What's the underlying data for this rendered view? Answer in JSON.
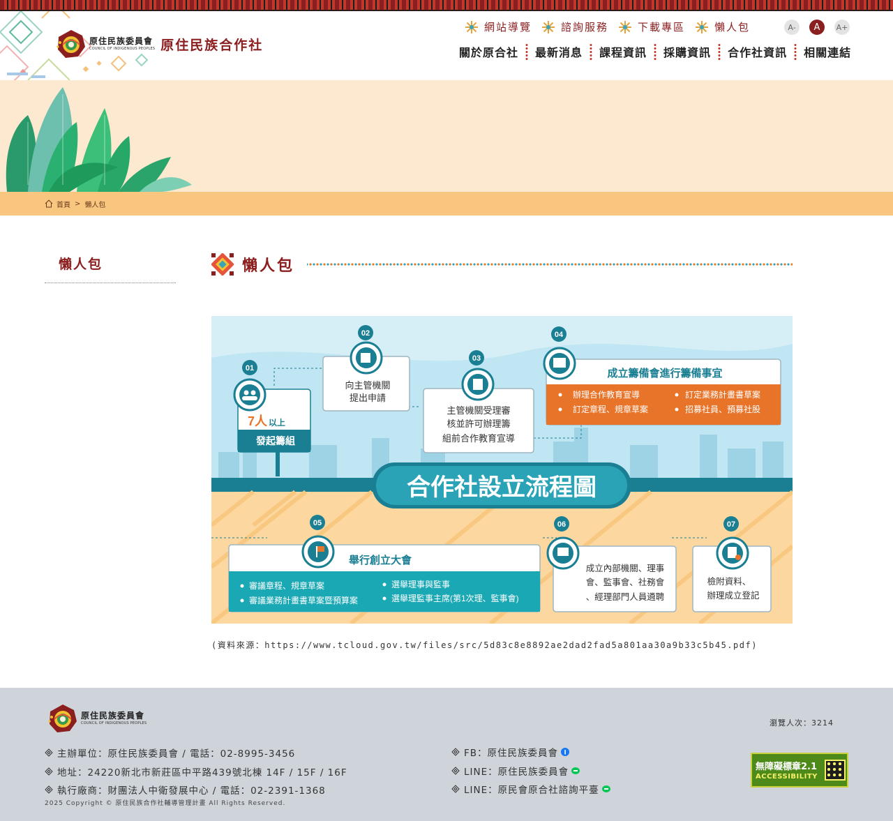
{
  "header": {
    "logo_cn": "原住民族委員會",
    "logo_en": "COUNCIL OF INDIGENOUS PEOPLES",
    "site_title": "原住民族合作社",
    "util_nav": [
      "網站導覽",
      "諮詢服務",
      "下載專區",
      "懶人包"
    ],
    "font_sizes": [
      "A-",
      "A",
      "A+"
    ],
    "main_nav": [
      "關於原合社",
      "最新消息",
      "課程資訊",
      "採購資訊",
      "合作社資訊",
      "相關連結"
    ]
  },
  "breadcrumb": {
    "home": "首頁",
    "separator": ">",
    "current": "懶人包"
  },
  "sidebar": {
    "title": "懶人包"
  },
  "content": {
    "title": "懶人包",
    "source_text": "(資料來源：https://www.tcloud.gov.tw/files/src/5d83c8e8892ae2dad2fad5a801aa30a9b33c5b45.pdf)"
  },
  "flowchart": {
    "title": "合作社設立流程圖",
    "steps": [
      {
        "num": "01",
        "highlight": "7人",
        "highlight_suffix": "以上",
        "label": "發起籌組"
      },
      {
        "num": "02",
        "lines": [
          "向主管機關",
          "提出申請"
        ]
      },
      {
        "num": "03",
        "lines": [
          "主管機關受理審",
          "核並許可辦理籌",
          "組前合作教育宣導"
        ]
      },
      {
        "num": "04",
        "title": "成立籌備會進行籌備事宜",
        "bullets": [
          "辦理合作教育宣導",
          "訂定業務計畫書草案",
          "訂定章程、規章草案",
          "招募社員、預募社股"
        ]
      },
      {
        "num": "05",
        "title": "舉行創立大會",
        "bullets": [
          "審議章程、規章草案",
          "選舉理事與監事",
          "審議業務計畫書草案暨預算案",
          "選舉理監事主席(第1次理、監事會)"
        ]
      },
      {
        "num": "06",
        "lines": [
          "成立內部機關、理事",
          "會、監事會、社務會",
          "、經理部門人員遴聘"
        ]
      },
      {
        "num": "07",
        "lines": [
          "檢附資料、",
          "辦理成立登記"
        ]
      }
    ]
  },
  "footer": {
    "logo_cn": "原住民族委員會",
    "logo_en": "COUNCIL OF INDIGENOUS PEOPLES",
    "visit": "瀏覽人次：3214",
    "left_lines": [
      "主辦單位：原住民族委員會 / 電話：02-8995-3456",
      "地址：24220新北市新莊區中平路439號北棟 14F / 15F / 16F",
      "執行廠商：財團法人中衛發展中心 / 電話：02-2391-1368"
    ],
    "right_lines": [
      "FB：原住民族委員會",
      "LINE：原住民族委員會",
      "LINE：原民會原合社諮詢平臺"
    ],
    "copyright": "2025 Copyright © 原住民族合作社輔導管理計畫 All Rights Reserved.",
    "badge_line1": "無障礙標章2.1",
    "badge_line2": "ACCESSIBILITY"
  },
  "colors": {
    "brand_red": "#8b1e1e",
    "banner_bg": "#fde8d0",
    "breadcrumb_bg": "#f9c680",
    "footer_bg": "#cfd4da",
    "flow_teal": "#1ba8b5",
    "flow_orange": "#e8742a"
  },
  "icons": [
    "sun-ornament-icon",
    "home-icon",
    "diamond-bullet-icon",
    "facebook-icon",
    "line-icon",
    "accessibility-badge-icon"
  ]
}
